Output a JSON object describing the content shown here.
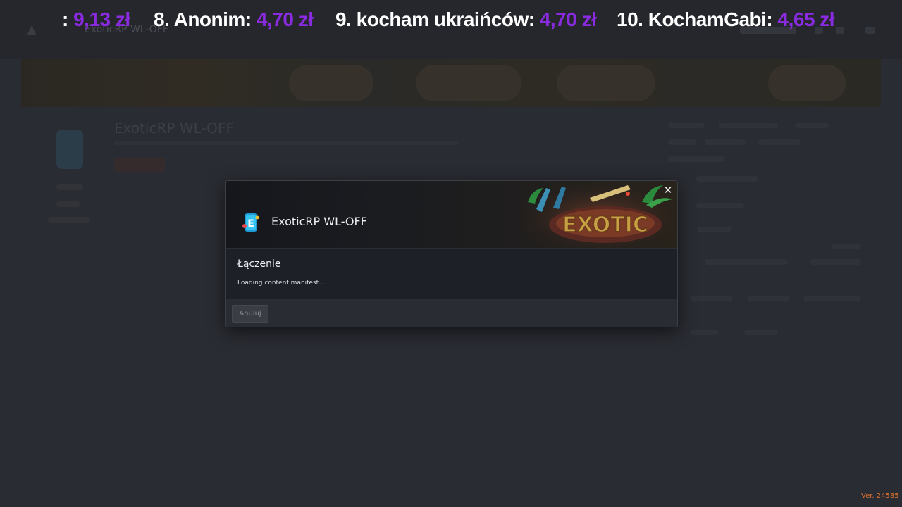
{
  "ticker": {
    "entries": [
      {
        "rank": "",
        "name": ":",
        "amount": "9,13 zł"
      },
      {
        "rank": "8.",
        "name": "Anonim:",
        "amount": "4,70 zł"
      },
      {
        "rank": "9.",
        "name": "kocham ukraińców:",
        "amount": "4,70 zł"
      },
      {
        "rank": "10.",
        "name": "KochamGabi:",
        "amount": "4,65 zł"
      }
    ]
  },
  "background": {
    "window_title": "ExoticRP WL-OFF",
    "server_title": "ExoticRP WL-OFF"
  },
  "dialog": {
    "server_name": "ExoticRP WL-OFF",
    "status_heading": "Łączenie",
    "status_detail": "Loading content manifest...",
    "cancel_label": "Anuluj",
    "close_glyph": "✕"
  },
  "footer": {
    "version": "Ver. 24585"
  },
  "colors": {
    "ticker_amount": "#8a2be2",
    "version": "#e0722b"
  }
}
